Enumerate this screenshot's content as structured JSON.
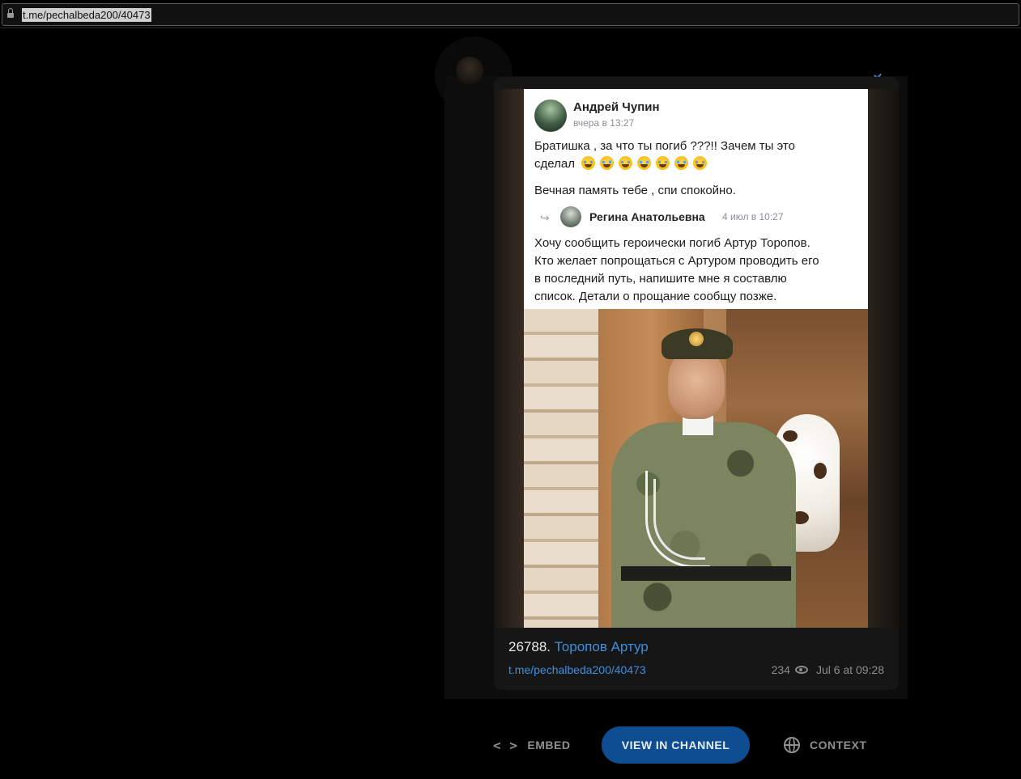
{
  "browser": {
    "url": "t.me/pechalbeda200/40473"
  },
  "vk_post": {
    "author": "Андрей Чупин",
    "time": "вчера в 13:27",
    "text_line1": "Братишка , за что ты погиб ???!! Зачем ты это",
    "text_line2": "сделал",
    "emoji_count": 7,
    "text_line3": "Вечная память тебе , спи спокойно.",
    "repost_author": "Регина Анатольевна",
    "repost_time": "4 июл в 10:27",
    "repost_line1": "Хочу сообщить героически погиб Артур Торопов.",
    "repost_line2": "Кто желает попрощаться с Артуром проводить его",
    "repost_line3": "в последний путь, напишите мне я составлю",
    "repost_line4": "список. Детали о прощание сообщу позже."
  },
  "message": {
    "caption_number": "26788.",
    "caption_link": "Торопов Артур",
    "link": "t.me/pechalbeda200/40473",
    "views": "234",
    "datetime": "Jul 6 at 09:28"
  },
  "actions": {
    "embed": "EMBED",
    "embed_icon": "< >",
    "view_in_channel": "VIEW IN CHANNEL",
    "context": "CONTEXT"
  },
  "colors": {
    "link": "#3d8fe0",
    "button_bg": "#0e4d92"
  }
}
